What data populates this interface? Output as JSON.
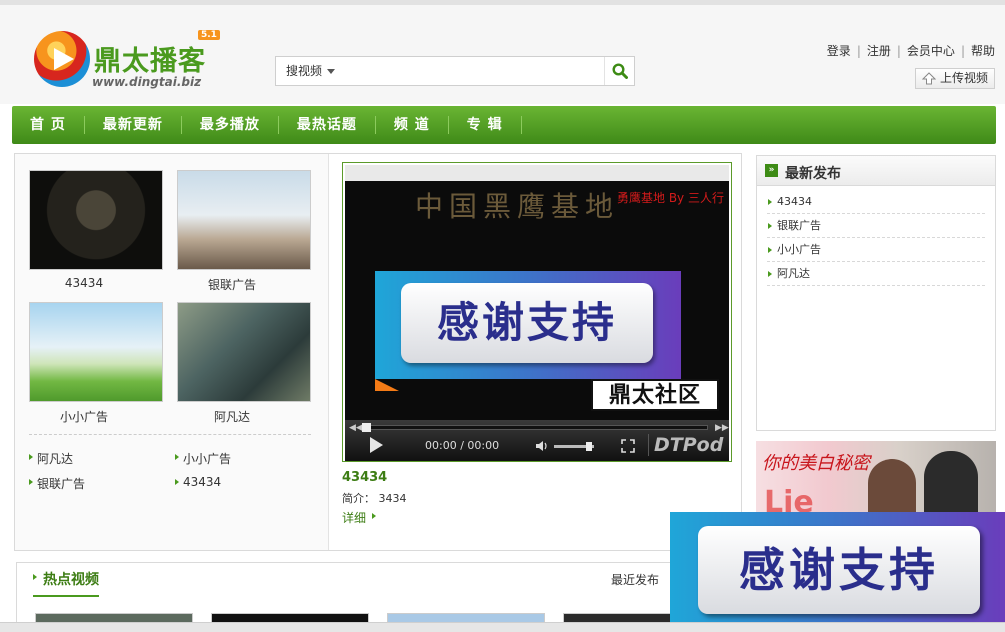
{
  "brand": {
    "title": "鼎太播客",
    "version": "5.1",
    "url": "www.dingtai.biz",
    "accent": "#4a9a1e"
  },
  "search": {
    "type_label": "搜视频",
    "placeholder": "",
    "button_icon": "search-icon"
  },
  "toplinks": [
    "登录",
    "注册",
    "会员中心",
    "帮助"
  ],
  "upload": {
    "label": "上传视频",
    "icon": "upload-icon"
  },
  "nav": [
    "首 页",
    "最新更新",
    "最多播放",
    "最热话题",
    "频 道",
    "专 辑"
  ],
  "thumbs": [
    {
      "caption": "43434"
    },
    {
      "caption": "银联广告"
    },
    {
      "caption": "小小广告"
    },
    {
      "caption": "阿凡达"
    }
  ],
  "text_links": [
    "阿凡达",
    "小小广告",
    "银联广告",
    "43434"
  ],
  "player": {
    "screen_title": "中国黑鹰基地",
    "screen_red": "勇鹰基地 By 三人行",
    "thanks": "感谢支持",
    "club": "鼎太社区",
    "time": "00:00 / 00:00",
    "brand": "DTPod"
  },
  "video": {
    "title": "43434",
    "desc_label": "简介：",
    "desc_value": "3434",
    "more": "详细"
  },
  "latest": {
    "title": "最新发布",
    "items": [
      "43434",
      "银联广告",
      "小小广告",
      "阿凡达"
    ]
  },
  "ad_photo": {
    "script": "你的美白秘密",
    "big": "Lie"
  },
  "overlay_ad": {
    "text": "感谢支持"
  },
  "hot": {
    "title": "热点视频",
    "tab": "最近发布"
  }
}
